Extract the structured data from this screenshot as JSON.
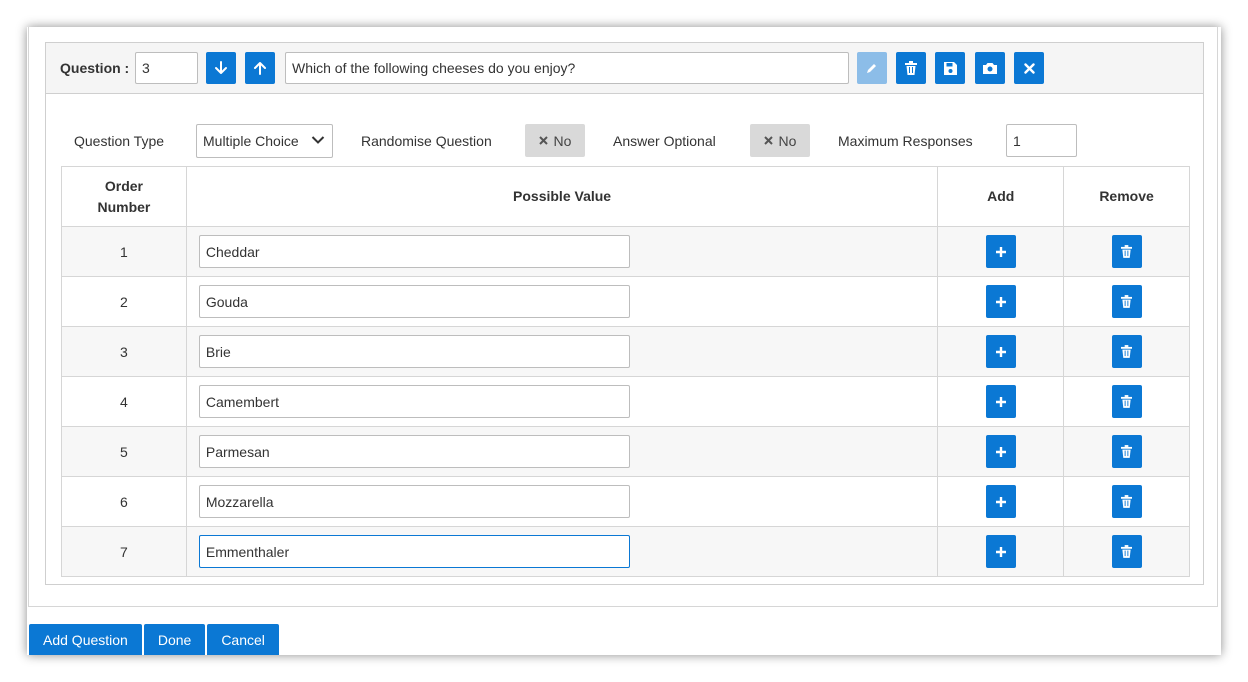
{
  "question": {
    "label": "Question :",
    "number": "3",
    "text": "Which of the following cheeses do you enjoy?"
  },
  "toolbar": {
    "move_down_icon": "arrow-down-icon",
    "move_up_icon": "arrow-up-icon",
    "edit_icon": "pencil-icon",
    "delete_icon": "trash-icon",
    "save_icon": "floppy-icon",
    "camera_icon": "camera-icon",
    "close_icon": "close-icon"
  },
  "options": {
    "question_type_label": "Question Type",
    "question_type_value": "Multiple Choice",
    "randomise_label": "Randomise Question",
    "randomise_value": "No",
    "optional_label": "Answer Optional",
    "optional_value": "No",
    "max_responses_label": "Maximum Responses",
    "max_responses_value": "1"
  },
  "table": {
    "headers": {
      "order_line1": "Order",
      "order_line2": "Number",
      "value": "Possible Value",
      "add": "Add",
      "remove": "Remove"
    },
    "rows": [
      {
        "order": "1",
        "value": "Cheddar"
      },
      {
        "order": "2",
        "value": "Gouda"
      },
      {
        "order": "3",
        "value": "Brie"
      },
      {
        "order": "4",
        "value": "Camembert"
      },
      {
        "order": "5",
        "value": "Parmesan"
      },
      {
        "order": "6",
        "value": "Mozzarella"
      },
      {
        "order": "7",
        "value": "Emmenthaler"
      }
    ]
  },
  "footer": {
    "add_question": "Add Question",
    "done": "Done",
    "cancel": "Cancel"
  },
  "colors": {
    "primary": "#0b78d4",
    "disabled": "#8cbde8",
    "toggle_bg": "#d9d9d9",
    "header_bg": "#f5f5f5"
  }
}
